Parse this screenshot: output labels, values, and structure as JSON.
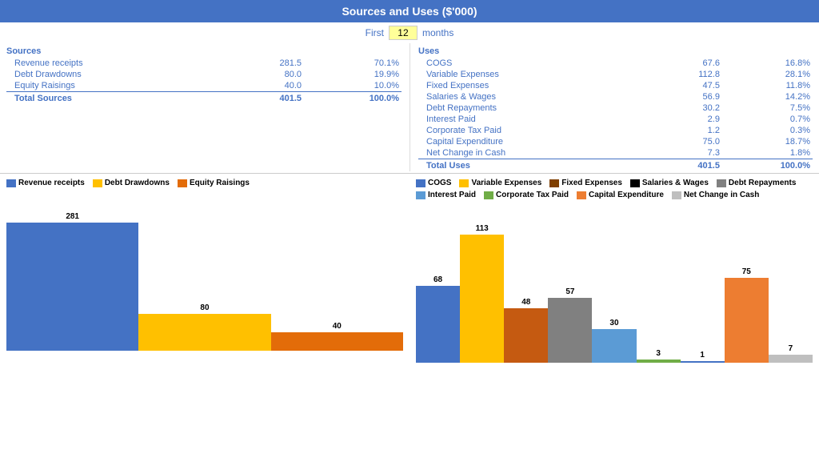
{
  "header": {
    "title": "Sources and Uses ($'000)"
  },
  "months_label_before": "First",
  "months_value": "12",
  "months_label_after": "months",
  "sources": {
    "section_title": "Sources",
    "items": [
      {
        "label": "Revenue receipts",
        "value": "281.5",
        "pct": "70.1%"
      },
      {
        "label": "Debt Drawdowns",
        "value": "80.0",
        "pct": "19.9%"
      },
      {
        "label": "Equity Raisings",
        "value": "40.0",
        "pct": "10.0%"
      }
    ],
    "total_label": "Total Sources",
    "total_value": "401.5",
    "total_pct": "100.0%"
  },
  "uses": {
    "section_title": "Uses",
    "items": [
      {
        "label": "COGS",
        "value": "67.6",
        "pct": "16.8%"
      },
      {
        "label": "Variable Expenses",
        "value": "112.8",
        "pct": "28.1%"
      },
      {
        "label": "Fixed Expenses",
        "value": "47.5",
        "pct": "11.8%"
      },
      {
        "label": "Salaries & Wages",
        "value": "56.9",
        "pct": "14.2%"
      },
      {
        "label": "Debt Repayments",
        "value": "30.2",
        "pct": "7.5%"
      },
      {
        "label": "Interest Paid",
        "value": "2.9",
        "pct": "0.7%"
      },
      {
        "label": "Corporate Tax Paid",
        "value": "1.2",
        "pct": "0.3%"
      },
      {
        "label": "Capital Expenditure",
        "value": "75.0",
        "pct": "18.7%"
      },
      {
        "label": "Net Change in Cash",
        "value": "7.3",
        "pct": "1.8%"
      }
    ],
    "total_label": "Total Uses",
    "total_value": "401.5",
    "total_pct": "100.0%"
  },
  "left_legend": [
    {
      "label": "Revenue receipts",
      "color": "#4472C4"
    },
    {
      "label": "Debt Drawdowns",
      "color": "#FFC000"
    },
    {
      "label": "Equity Raisings",
      "color": "#E36C09"
    }
  ],
  "left_bars": [
    {
      "label": "281",
      "value": 281,
      "max": 281,
      "color": "#4472C4"
    },
    {
      "label": "80",
      "value": 80,
      "max": 281,
      "color": "#FFC000"
    },
    {
      "label": "40",
      "value": 40,
      "max": 281,
      "color": "#E36C09"
    }
  ],
  "right_legend": [
    {
      "label": "COGS",
      "color": "#4472C4"
    },
    {
      "label": "Variable Expenses",
      "color": "#FFC000"
    },
    {
      "label": "Fixed Expenses",
      "color": "#7F3F00"
    },
    {
      "label": "Salaries & Wages",
      "color": "#000000"
    },
    {
      "label": "Debt Repayments",
      "color": "#808080"
    },
    {
      "label": "Interest Paid",
      "color": "#5B9BD5"
    },
    {
      "label": "Corporate Tax Paid",
      "color": "#70AD47"
    },
    {
      "label": "Capital Expenditure",
      "color": "#ED7D31"
    },
    {
      "label": "Net Change in Cash",
      "color": "#BFBFBF"
    }
  ],
  "right_bars": [
    {
      "label": "68",
      "value": 68,
      "max": 113,
      "color": "#4472C4"
    },
    {
      "label": "113",
      "value": 113,
      "max": 113,
      "color": "#FFC000"
    },
    {
      "label": "48",
      "value": 48,
      "max": 113,
      "color": "#C55A11"
    },
    {
      "label": "57",
      "value": 57,
      "max": 113,
      "color": "#808080"
    },
    {
      "label": "30",
      "value": 30,
      "max": 113,
      "color": "#5B9BD5"
    },
    {
      "label": "3",
      "value": 3,
      "max": 113,
      "color": "#70AD47"
    },
    {
      "label": "1",
      "value": 1,
      "max": 113,
      "color": "#4472C4"
    },
    {
      "label": "75",
      "value": 75,
      "max": 113,
      "color": "#ED7D31"
    },
    {
      "label": "7",
      "value": 7,
      "max": 113,
      "color": "#BFBFBF"
    }
  ]
}
